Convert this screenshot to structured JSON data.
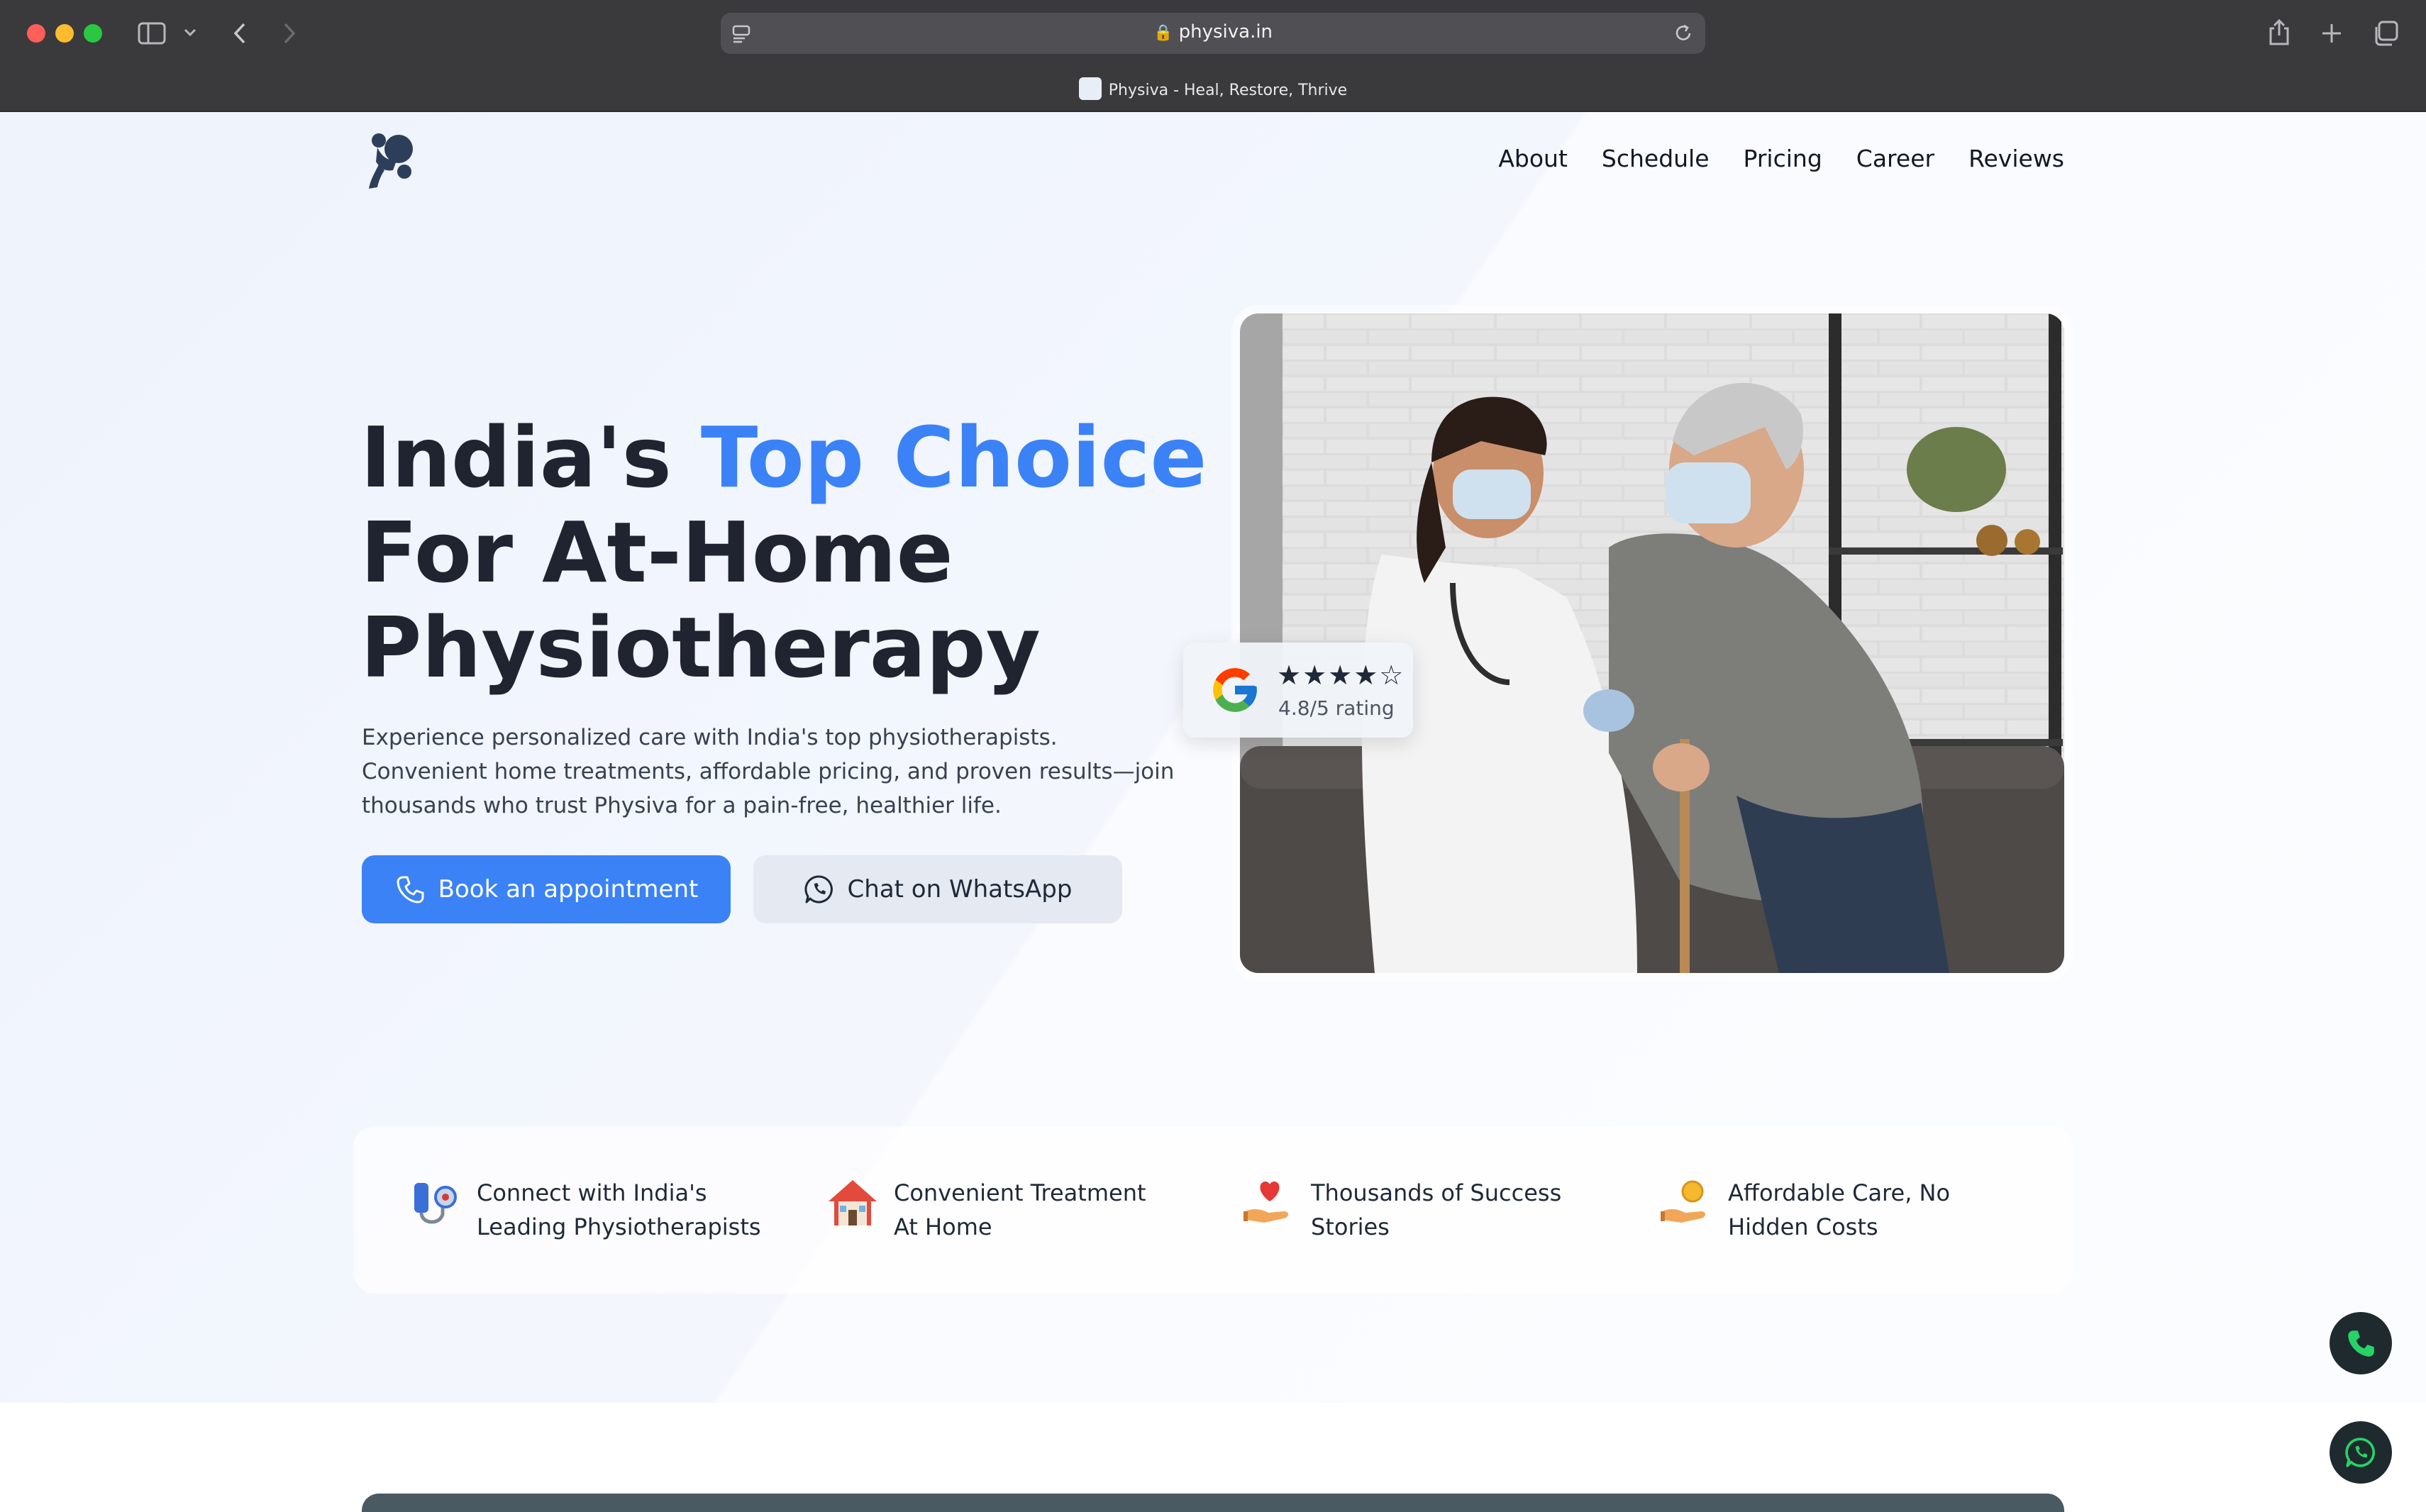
{
  "browser": {
    "url": "physiva.in",
    "tab_title": "Physiva - Heal, Restore, Thrive"
  },
  "nav": {
    "items": [
      {
        "label": "About"
      },
      {
        "label": "Schedule"
      },
      {
        "label": "Pricing"
      },
      {
        "label": "Career"
      },
      {
        "label": "Reviews"
      }
    ]
  },
  "hero": {
    "headline_part1": "India's ",
    "headline_accent": "Top Choice",
    "headline_line2": "For At-Home",
    "headline_line3": "Physiotherapy",
    "lead": "Experience personalized care with India's top physiotherapists. Convenient home treatments, affordable pricing, and proven results—join thousands who trust Physiva for a pain-free, healthier life.",
    "primary_cta": "Book an appointment",
    "secondary_cta": "Chat on WhatsApp"
  },
  "rating": {
    "stars": "★★★★☆",
    "text": "4.8/5 rating",
    "value": 4.8,
    "max": 5
  },
  "features": [
    {
      "icon": "stethoscope-icon",
      "line1": "Connect with India's",
      "line2": "Leading Physiotherapists"
    },
    {
      "icon": "house-icon",
      "line1": "Convenient Treatment",
      "line2": "At Home"
    },
    {
      "icon": "heart-hand-icon",
      "line1": "Thousands of Success",
      "line2": "Stories"
    },
    {
      "icon": "coin-hand-icon",
      "line1": "Affordable Care, No",
      "line2": "Hidden Costs"
    }
  ],
  "colors": {
    "accent": "#3b82f6",
    "heading": "#1f2430",
    "floating_button": "#1f2a2e",
    "whatsapp_green": "#25d366"
  }
}
